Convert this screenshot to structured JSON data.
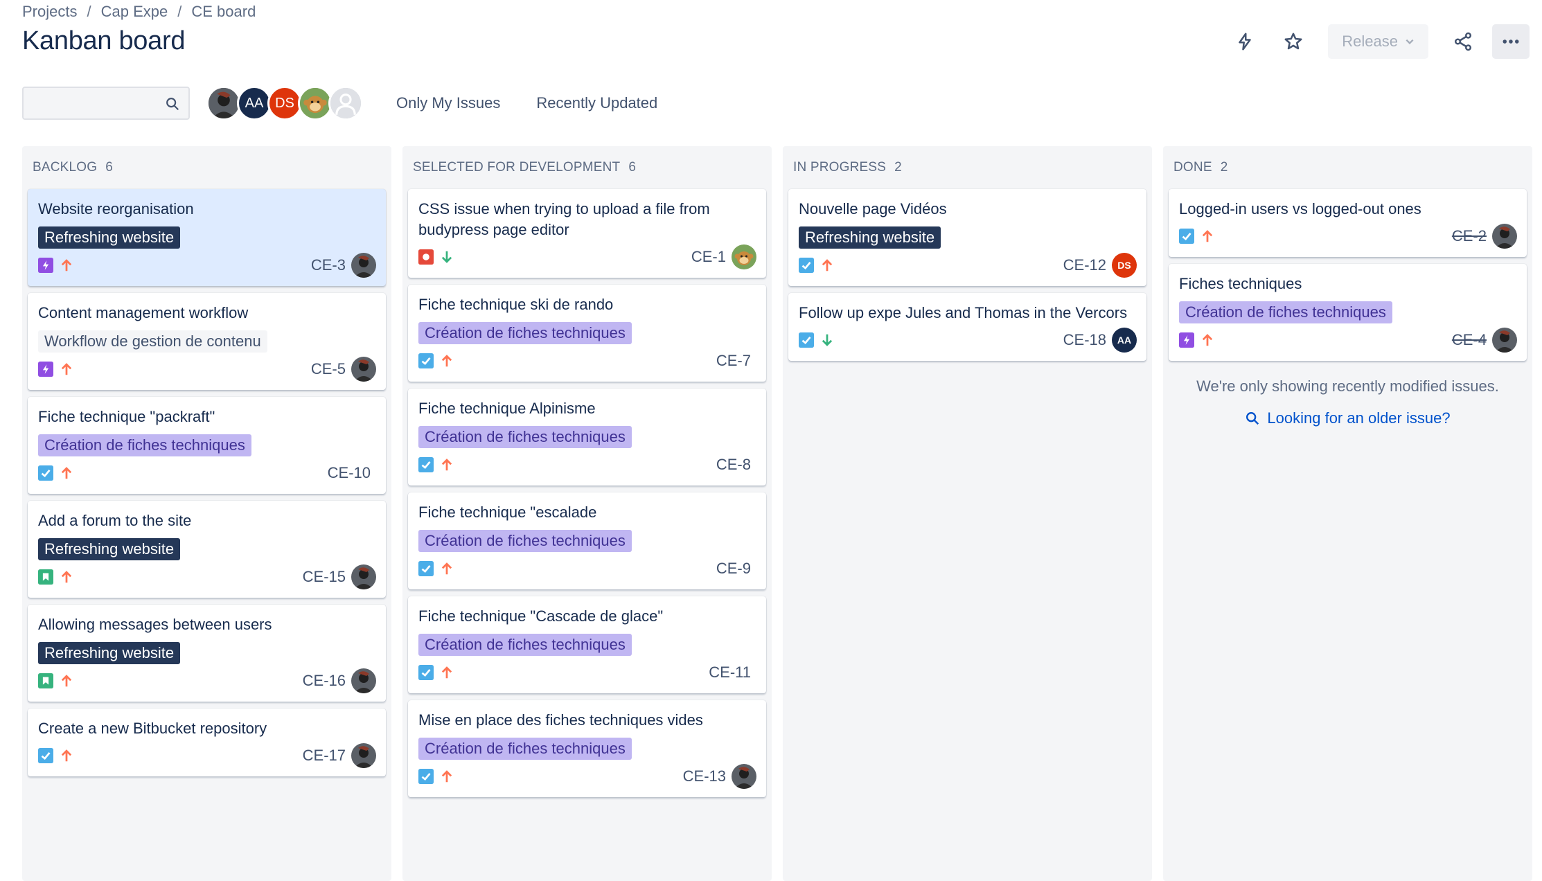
{
  "breadcrumb": {
    "items": [
      "Projects",
      "Cap Expe",
      "CE board"
    ],
    "separator": "/"
  },
  "page_title": "Kanban board",
  "header": {
    "release_label": "Release",
    "icons": [
      "lightning-icon",
      "star-icon",
      "chevron-down-icon",
      "share-icon",
      "more-icon"
    ]
  },
  "toolbar": {
    "search_placeholder": "",
    "avatars": [
      {
        "initials": "",
        "kind": "photo",
        "color": "#3b3b3b"
      },
      {
        "initials": "AA",
        "kind": "initials",
        "color": "#172b4d"
      },
      {
        "initials": "DS",
        "kind": "initials",
        "color": "#de350b"
      },
      {
        "initials": "",
        "kind": "monkey",
        "color": "#6b8e4e"
      },
      {
        "initials": "",
        "kind": "placeholder",
        "color": "#c1c7d0"
      }
    ],
    "filters": [
      "Only My Issues",
      "Recently Updated"
    ]
  },
  "colors": {
    "epic_dark_bg": "#253858",
    "epic_purple_bg": "#c0b6f2",
    "epic_purple_text": "#403294",
    "epic_gray_bg": "#f4f5f7",
    "story_green": "#36b37e",
    "task_blue": "#4bade8",
    "epic_purple_icon": "#904ee2",
    "bug_red": "#e5493a",
    "priority_high": "#ff7452",
    "priority_low": "#36b37e",
    "selected_card": "#deebff",
    "link_blue": "#0052cc"
  },
  "columns": [
    {
      "name": "BACKLOG",
      "count": "6",
      "cards": [
        {
          "title": "Website reorganisation",
          "epic": "Refreshing website",
          "epic_style": "dark",
          "type": "epic",
          "priority": "high",
          "key": "CE-3",
          "avatar": "photo",
          "selected": true
        },
        {
          "title": "Content management workflow",
          "epic": "Workflow de gestion de contenu",
          "epic_style": "gray",
          "type": "epic",
          "priority": "high",
          "key": "CE-5",
          "avatar": "photo"
        },
        {
          "title": "Fiche technique \"packraft\"",
          "epic": "Création de fiches techniques",
          "epic_style": "purple",
          "type": "task",
          "priority": "high",
          "key": "CE-10",
          "avatar": ""
        },
        {
          "title": "Add a forum to the site",
          "epic": "Refreshing website",
          "epic_style": "dark",
          "type": "story",
          "priority": "high",
          "key": "CE-15",
          "avatar": "photo"
        },
        {
          "title": "Allowing messages between users",
          "epic": "Refreshing website",
          "epic_style": "dark",
          "type": "story",
          "priority": "high",
          "key": "CE-16",
          "avatar": "photo"
        },
        {
          "title": "Create a new Bitbucket repository",
          "epic": "",
          "epic_style": "",
          "type": "task",
          "priority": "high",
          "key": "CE-17",
          "avatar": "photo"
        }
      ]
    },
    {
      "name": "SELECTED FOR DEVELOPMENT",
      "count": "6",
      "cards": [
        {
          "title": "CSS issue when trying to upload a file from budypress page editor",
          "epic": "",
          "epic_style": "",
          "type": "bug",
          "priority": "low",
          "key": "CE-1",
          "avatar": "monkey"
        },
        {
          "title": "Fiche technique ski de rando",
          "epic": "Création de fiches techniques",
          "epic_style": "purple",
          "type": "task",
          "priority": "high",
          "key": "CE-7",
          "avatar": ""
        },
        {
          "title": "Fiche technique Alpinisme",
          "epic": "Création de fiches techniques",
          "epic_style": "purple",
          "type": "task",
          "priority": "high",
          "key": "CE-8",
          "avatar": ""
        },
        {
          "title": "Fiche technique \"escalade",
          "epic": "Création de fiches techniques",
          "epic_style": "purple",
          "type": "task",
          "priority": "high",
          "key": "CE-9",
          "avatar": ""
        },
        {
          "title": "Fiche technique \"Cascade de glace\"",
          "epic": "Création de fiches techniques",
          "epic_style": "purple",
          "type": "task",
          "priority": "high",
          "key": "CE-11",
          "avatar": ""
        },
        {
          "title": "Mise en place des fiches techniques vides",
          "epic": "Création de fiches techniques",
          "epic_style": "purple",
          "type": "task",
          "priority": "high",
          "key": "CE-13",
          "avatar": "photo"
        }
      ]
    },
    {
      "name": "IN PROGRESS",
      "count": "2",
      "cards": [
        {
          "title": "Nouvelle page Vidéos",
          "epic": "Refreshing website",
          "epic_style": "dark",
          "type": "task",
          "priority": "high",
          "key": "CE-12",
          "avatar": "DS"
        },
        {
          "title": "Follow up expe Jules and Thomas in the Vercors",
          "epic": "",
          "epic_style": "",
          "type": "task",
          "priority": "low",
          "key": "CE-18",
          "avatar": "AA"
        }
      ]
    },
    {
      "name": "DONE",
      "count": "2",
      "cards": [
        {
          "title": "Logged-in users vs logged-out ones",
          "epic": "",
          "epic_style": "",
          "type": "task",
          "priority": "high",
          "key": "CE-2",
          "avatar": "photo",
          "done": true
        },
        {
          "title": "Fiches techniques",
          "epic": "Création de fiches techniques",
          "epic_style": "purple",
          "type": "epic",
          "priority": "high",
          "key": "CE-4",
          "avatar": "photo",
          "done": true
        }
      ],
      "note": "We're only showing recently modified issues.",
      "link": "Looking for an older issue?"
    }
  ]
}
